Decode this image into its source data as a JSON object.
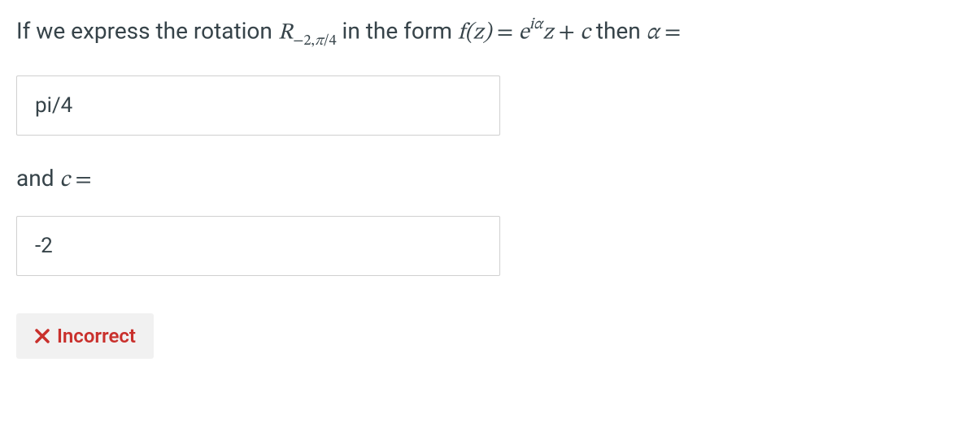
{
  "question": {
    "prefix": "If we express the rotation ",
    "rotation_symbol": "R",
    "rotation_subscript_minus": "−2,",
    "rotation_subscript_pi": "π",
    "rotation_subscript_slash4": "/4",
    "middle": " in the form ",
    "f_of_z": "f(z)",
    "equals1": " = ",
    "e": "e",
    "exp_i": "i",
    "exp_alpha": "α",
    "z": "z",
    "plus": " + ",
    "c1": "c",
    "then_text": "  then ",
    "alpha": "α",
    "equals2": " ="
  },
  "answers": {
    "alpha_value": "pi/4",
    "c_value": "-2"
  },
  "sub_label": {
    "and": "and ",
    "c": "c",
    "equals": " ="
  },
  "feedback": {
    "text": "Incorrect"
  }
}
